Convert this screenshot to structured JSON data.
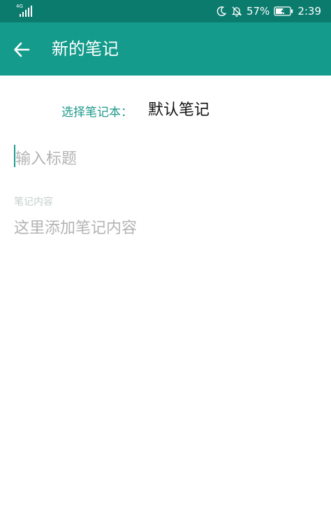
{
  "status_bar": {
    "network": "4G",
    "battery_percent": "57%",
    "time": "2:39",
    "icons": [
      "signal-icon",
      "moon-icon",
      "bell-off-icon",
      "battery-charging-icon"
    ]
  },
  "app_bar": {
    "back_icon": "arrow-left-icon",
    "title": "新的笔记"
  },
  "form": {
    "notebook_label": "选择笔记本：",
    "notebook_value": "默认笔记",
    "title_placeholder": "输入标题",
    "content_label": "笔记内容",
    "content_placeholder": "这里添加笔记内容"
  },
  "colors": {
    "status_bar": "#0b7b6e",
    "app_bar": "#149b8b",
    "accent": "#1e9a8b",
    "placeholder": "#b3b3b3"
  }
}
